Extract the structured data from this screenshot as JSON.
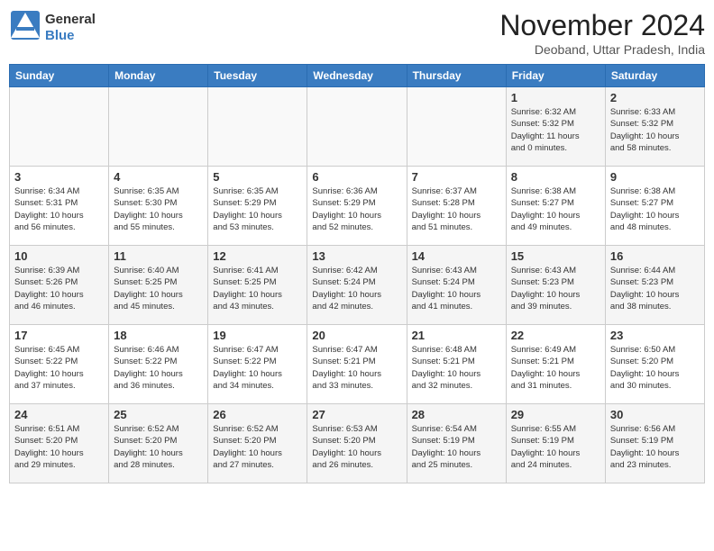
{
  "header": {
    "logo": {
      "line1": "General",
      "line2": "Blue"
    },
    "title": "November 2024",
    "subtitle": "Deoband, Uttar Pradesh, India"
  },
  "weekdays": [
    "Sunday",
    "Monday",
    "Tuesday",
    "Wednesday",
    "Thursday",
    "Friday",
    "Saturday"
  ],
  "weeks": [
    [
      {
        "day": "",
        "info": ""
      },
      {
        "day": "",
        "info": ""
      },
      {
        "day": "",
        "info": ""
      },
      {
        "day": "",
        "info": ""
      },
      {
        "day": "",
        "info": ""
      },
      {
        "day": "1",
        "info": "Sunrise: 6:32 AM\nSunset: 5:32 PM\nDaylight: 11 hours\nand 0 minutes."
      },
      {
        "day": "2",
        "info": "Sunrise: 6:33 AM\nSunset: 5:32 PM\nDaylight: 10 hours\nand 58 minutes."
      }
    ],
    [
      {
        "day": "3",
        "info": "Sunrise: 6:34 AM\nSunset: 5:31 PM\nDaylight: 10 hours\nand 56 minutes."
      },
      {
        "day": "4",
        "info": "Sunrise: 6:35 AM\nSunset: 5:30 PM\nDaylight: 10 hours\nand 55 minutes."
      },
      {
        "day": "5",
        "info": "Sunrise: 6:35 AM\nSunset: 5:29 PM\nDaylight: 10 hours\nand 53 minutes."
      },
      {
        "day": "6",
        "info": "Sunrise: 6:36 AM\nSunset: 5:29 PM\nDaylight: 10 hours\nand 52 minutes."
      },
      {
        "day": "7",
        "info": "Sunrise: 6:37 AM\nSunset: 5:28 PM\nDaylight: 10 hours\nand 51 minutes."
      },
      {
        "day": "8",
        "info": "Sunrise: 6:38 AM\nSunset: 5:27 PM\nDaylight: 10 hours\nand 49 minutes."
      },
      {
        "day": "9",
        "info": "Sunrise: 6:38 AM\nSunset: 5:27 PM\nDaylight: 10 hours\nand 48 minutes."
      }
    ],
    [
      {
        "day": "10",
        "info": "Sunrise: 6:39 AM\nSunset: 5:26 PM\nDaylight: 10 hours\nand 46 minutes."
      },
      {
        "day": "11",
        "info": "Sunrise: 6:40 AM\nSunset: 5:25 PM\nDaylight: 10 hours\nand 45 minutes."
      },
      {
        "day": "12",
        "info": "Sunrise: 6:41 AM\nSunset: 5:25 PM\nDaylight: 10 hours\nand 43 minutes."
      },
      {
        "day": "13",
        "info": "Sunrise: 6:42 AM\nSunset: 5:24 PM\nDaylight: 10 hours\nand 42 minutes."
      },
      {
        "day": "14",
        "info": "Sunrise: 6:43 AM\nSunset: 5:24 PM\nDaylight: 10 hours\nand 41 minutes."
      },
      {
        "day": "15",
        "info": "Sunrise: 6:43 AM\nSunset: 5:23 PM\nDaylight: 10 hours\nand 39 minutes."
      },
      {
        "day": "16",
        "info": "Sunrise: 6:44 AM\nSunset: 5:23 PM\nDaylight: 10 hours\nand 38 minutes."
      }
    ],
    [
      {
        "day": "17",
        "info": "Sunrise: 6:45 AM\nSunset: 5:22 PM\nDaylight: 10 hours\nand 37 minutes."
      },
      {
        "day": "18",
        "info": "Sunrise: 6:46 AM\nSunset: 5:22 PM\nDaylight: 10 hours\nand 36 minutes."
      },
      {
        "day": "19",
        "info": "Sunrise: 6:47 AM\nSunset: 5:22 PM\nDaylight: 10 hours\nand 34 minutes."
      },
      {
        "day": "20",
        "info": "Sunrise: 6:47 AM\nSunset: 5:21 PM\nDaylight: 10 hours\nand 33 minutes."
      },
      {
        "day": "21",
        "info": "Sunrise: 6:48 AM\nSunset: 5:21 PM\nDaylight: 10 hours\nand 32 minutes."
      },
      {
        "day": "22",
        "info": "Sunrise: 6:49 AM\nSunset: 5:21 PM\nDaylight: 10 hours\nand 31 minutes."
      },
      {
        "day": "23",
        "info": "Sunrise: 6:50 AM\nSunset: 5:20 PM\nDaylight: 10 hours\nand 30 minutes."
      }
    ],
    [
      {
        "day": "24",
        "info": "Sunrise: 6:51 AM\nSunset: 5:20 PM\nDaylight: 10 hours\nand 29 minutes."
      },
      {
        "day": "25",
        "info": "Sunrise: 6:52 AM\nSunset: 5:20 PM\nDaylight: 10 hours\nand 28 minutes."
      },
      {
        "day": "26",
        "info": "Sunrise: 6:52 AM\nSunset: 5:20 PM\nDaylight: 10 hours\nand 27 minutes."
      },
      {
        "day": "27",
        "info": "Sunrise: 6:53 AM\nSunset: 5:20 PM\nDaylight: 10 hours\nand 26 minutes."
      },
      {
        "day": "28",
        "info": "Sunrise: 6:54 AM\nSunset: 5:19 PM\nDaylight: 10 hours\nand 25 minutes."
      },
      {
        "day": "29",
        "info": "Sunrise: 6:55 AM\nSunset: 5:19 PM\nDaylight: 10 hours\nand 24 minutes."
      },
      {
        "day": "30",
        "info": "Sunrise: 6:56 AM\nSunset: 5:19 PM\nDaylight: 10 hours\nand 23 minutes."
      }
    ]
  ]
}
